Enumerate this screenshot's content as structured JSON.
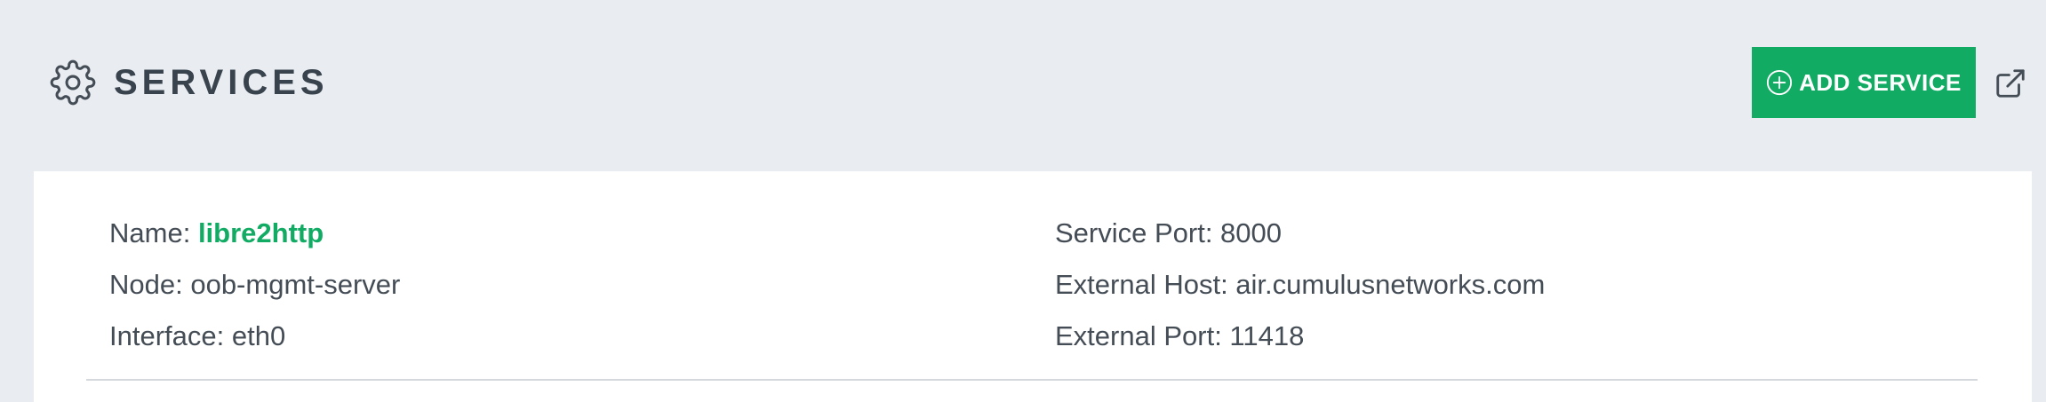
{
  "header": {
    "title": "SERVICES",
    "icon": "gear-icon",
    "add_button_label": "ADD SERVICE",
    "add_button_icon": "plus-circle-icon",
    "external_icon": "external-link-icon"
  },
  "service": {
    "name_label": "Name:",
    "name_value": "libre2http",
    "node": "Node: oob-mgmt-server",
    "interface": "Interface: eth0",
    "service_port": "Service Port: 8000",
    "external_host": "External Host: air.cumulusnetworks.com",
    "external_port": "External Port: 11418"
  },
  "colors": {
    "accent": "#12ab64",
    "background": "#e9ecf1",
    "card": "#ffffff",
    "text": "#444c55",
    "title": "#39434d"
  }
}
